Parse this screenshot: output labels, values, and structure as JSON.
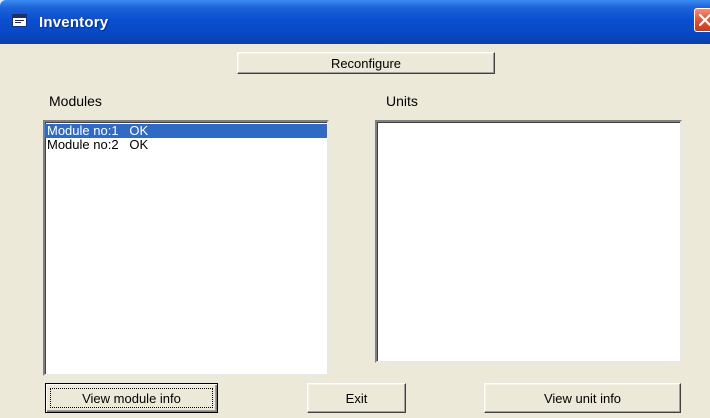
{
  "window": {
    "title": "Inventory",
    "title_icon": "window-app-icon",
    "close_icon": "close-icon"
  },
  "buttons": {
    "reconfigure": "Reconfigure",
    "view_module_info": "View module info",
    "exit": "Exit",
    "view_unit_info": "View unit info"
  },
  "labels": {
    "modules": "Modules",
    "units": "Units"
  },
  "modules_list": {
    "items": [
      {
        "label": "Module no:1   OK",
        "selected": true
      },
      {
        "label": "Module no:2   OK",
        "selected": false
      }
    ]
  },
  "units_list": {
    "items": []
  },
  "colors": {
    "titlebar": "#0a4fd0",
    "window_bg": "#ece9d8",
    "selection": "#316ac5",
    "close_button": "#e05a3c"
  }
}
